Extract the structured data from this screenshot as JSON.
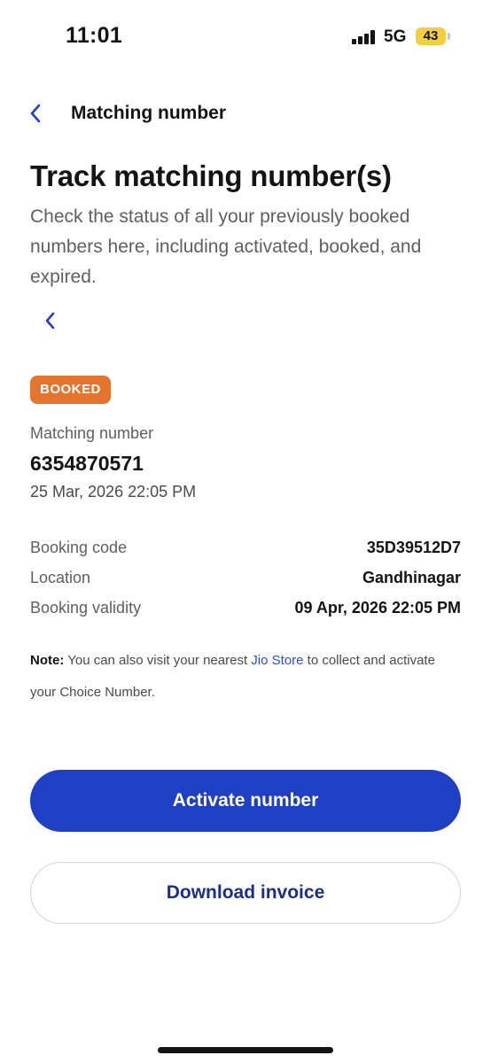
{
  "status_bar": {
    "time": "11:01",
    "network": "5G",
    "battery": "43",
    "battery_color": "#f3cf3e"
  },
  "header": {
    "back_icon": "chevron-left-icon",
    "title": "Matching number"
  },
  "page": {
    "title": "Track matching number(s)",
    "description": "Check the status of all your previously booked numbers here, including activated, booked, and expired.",
    "prev_icon": "chevron-left-icon"
  },
  "booking": {
    "status_badge": "BOOKED",
    "status_color": "#e5752e",
    "matching_label": "Matching number",
    "matching_number": "6354870571",
    "booked_date": "25 Mar, 2026 22:05 PM",
    "details": [
      {
        "label": "Booking code",
        "value": "35D39512D7"
      },
      {
        "label": "Location",
        "value": "Gandhinagar"
      },
      {
        "label": "Booking validity",
        "value": "09 Apr, 2026 22:05 PM"
      }
    ]
  },
  "note": {
    "prefix": "Note:",
    "text_before": " You can also visit your nearest ",
    "link": "Jio Store",
    "text_after": " to collect and activate your Choice Number."
  },
  "actions": {
    "primary_label": "Activate number",
    "secondary_label": "Download invoice",
    "primary_color": "#1f3fc4"
  }
}
